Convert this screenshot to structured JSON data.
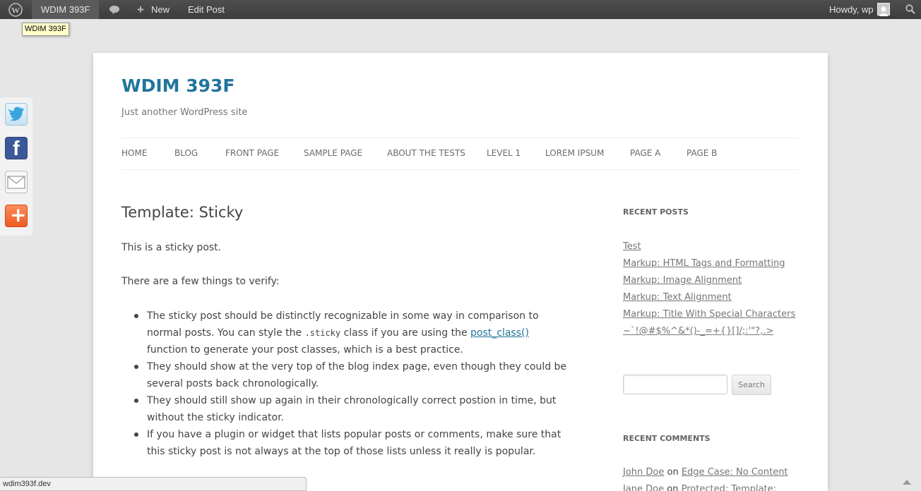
{
  "adminbar": {
    "site_name": "WDIM 393F",
    "new_label": "New",
    "edit_label": "Edit Post",
    "howdy": "Howdy, wp"
  },
  "tooltip": "WDIM 393F",
  "site": {
    "title": "WDIM 393F",
    "description": "Just another WordPress site"
  },
  "nav": {
    "items": [
      "HOME",
      "BLOG",
      "FRONT PAGE",
      "SAMPLE PAGE",
      "ABOUT THE TESTS",
      "LEVEL 1",
      "LOREM IPSUM",
      "PAGE A",
      "PAGE B"
    ]
  },
  "post": {
    "title": "Template: Sticky",
    "p1": "This is a sticky post.",
    "p2": "There are a few things to verify:",
    "b1_a": "The sticky post should be distinctly recognizable in some way in comparison to normal posts. You can style the ",
    "b1_code": ".sticky",
    "b1_b": " class if you are using the ",
    "b1_link": "post_class()",
    "b1_c": " function to generate your post classes, which is a best practice.",
    "b2": "They should show at the very top of the blog index page, even though they could be several posts back chronologically.",
    "b3": "They should still show up again in their chronologically correct postion in time, but without the sticky indicator.",
    "b4": "If you have a plugin or widget that lists popular posts or comments, make sure that this sticky post is not always at the top of those lists unless it really is popular."
  },
  "sidebar": {
    "recent_posts_title": "RECENT POSTS",
    "recent_posts": [
      "Test",
      "Markup: HTML Tags and Formatting",
      "Markup: Image Alignment",
      "Markup: Text Alignment",
      "Markup: Title With Special Characters",
      "~`!@#$%^&*()-_=+{}[]/;:'\"?,.>"
    ],
    "search_button": "Search",
    "search_value": "",
    "recent_comments_title": "RECENT COMMENTS",
    "comment1_author": "John Doe",
    "comment1_on": " on ",
    "comment1_post": "Edge Case: No Content",
    "comment2_author": "Jane Doe",
    "comment2_on": " on ",
    "comment2_post": "Protected: Template:"
  },
  "statusbar": "wdim393f.dev"
}
